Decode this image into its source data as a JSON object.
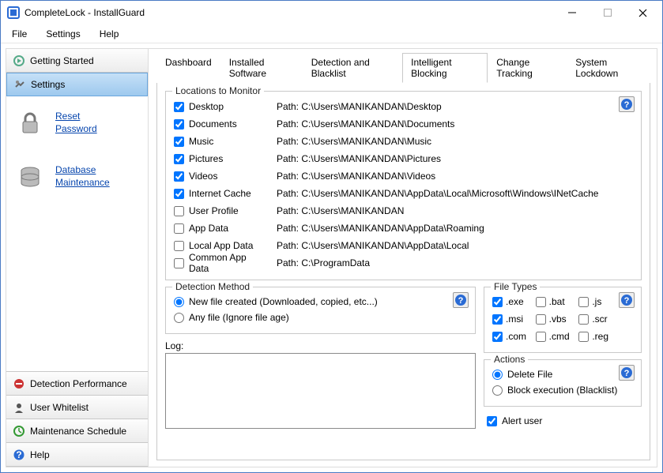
{
  "window": {
    "title": "CompleteLock - InstallGuard"
  },
  "menu": {
    "file": "File",
    "settings": "Settings",
    "help": "Help"
  },
  "sidebar": {
    "top": [
      {
        "label": "Getting Started",
        "icon": "getting-started"
      },
      {
        "label": "Settings",
        "icon": "settings",
        "selected": true
      }
    ],
    "links": [
      {
        "label": "Reset Password",
        "icon": "lock"
      },
      {
        "label": "Database Maintenance",
        "icon": "database"
      }
    ],
    "bottom": [
      {
        "label": "Detection Performance",
        "icon": "performance"
      },
      {
        "label": "User Whitelist",
        "icon": "user"
      },
      {
        "label": "Maintenance Schedule",
        "icon": "schedule"
      },
      {
        "label": "Help",
        "icon": "help"
      }
    ]
  },
  "tabs": [
    "Dashboard",
    "Installed Software",
    "Detection and Blacklist",
    "Intelligent Blocking",
    "Change Tracking",
    "System Lockdown"
  ],
  "active_tab": 3,
  "locations": {
    "legend": "Locations to Monitor",
    "items": [
      {
        "label": "Desktop",
        "checked": true,
        "path": "Path: C:\\Users\\MANIKANDAN\\Desktop"
      },
      {
        "label": "Documents",
        "checked": true,
        "path": "Path: C:\\Users\\MANIKANDAN\\Documents"
      },
      {
        "label": "Music",
        "checked": true,
        "path": "Path: C:\\Users\\MANIKANDAN\\Music"
      },
      {
        "label": "Pictures",
        "checked": true,
        "path": "Path: C:\\Users\\MANIKANDAN\\Pictures"
      },
      {
        "label": "Videos",
        "checked": true,
        "path": "Path: C:\\Users\\MANIKANDAN\\Videos"
      },
      {
        "label": "Internet Cache",
        "checked": true,
        "path": "Path: C:\\Users\\MANIKANDAN\\AppData\\Local\\Microsoft\\Windows\\INetCache"
      },
      {
        "label": "User Profile",
        "checked": false,
        "path": "Path: C:\\Users\\MANIKANDAN"
      },
      {
        "label": "App Data",
        "checked": false,
        "path": "Path: C:\\Users\\MANIKANDAN\\AppData\\Roaming"
      },
      {
        "label": "Local App Data",
        "checked": false,
        "path": "Path: C:\\Users\\MANIKANDAN\\AppData\\Local"
      },
      {
        "label": "Common App Data",
        "checked": false,
        "path": "Path: C:\\ProgramData"
      }
    ]
  },
  "detection": {
    "legend": "Detection Method",
    "options": [
      {
        "label": "New file created (Downloaded, copied, etc...)",
        "selected": true
      },
      {
        "label": "Any file (Ignore file age)",
        "selected": false
      }
    ]
  },
  "log_label": "Log:",
  "filetypes": {
    "legend": "File Types",
    "items": [
      {
        "ext": ".exe",
        "checked": true
      },
      {
        "ext": ".bat",
        "checked": false
      },
      {
        "ext": ".js",
        "checked": false
      },
      {
        "ext": ".msi",
        "checked": true
      },
      {
        "ext": ".vbs",
        "checked": false
      },
      {
        "ext": ".scr",
        "checked": false
      },
      {
        "ext": ".com",
        "checked": true
      },
      {
        "ext": ".cmd",
        "checked": false
      },
      {
        "ext": ".reg",
        "checked": false
      }
    ]
  },
  "actions": {
    "legend": "Actions",
    "options": [
      {
        "label": "Delete File",
        "selected": true
      },
      {
        "label": "Block execution (Blacklist)",
        "selected": false
      }
    ],
    "alert_user": {
      "label": "Alert user",
      "checked": true
    }
  }
}
